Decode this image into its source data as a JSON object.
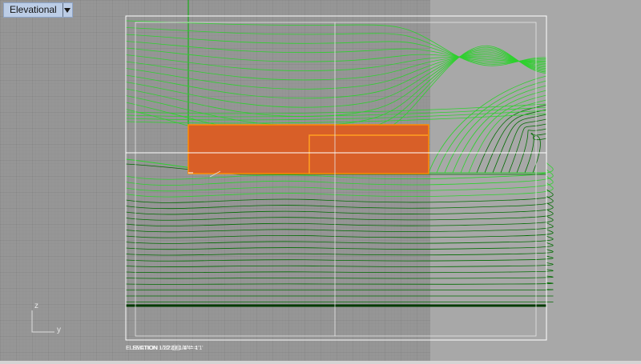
{
  "viewport": {
    "title": "Elevational",
    "menu_icon": "triangle-down-icon",
    "caption_text": "ELEVATION 1/22 @ 1/4\" = 1'",
    "caption_overlap_text": "SECTION - 1/22 @ 1/4\" = 1'",
    "axes": {
      "vertical_label": "z",
      "horizontal_label": "y"
    },
    "colors": {
      "background_left": "#969696",
      "background_right": "#a8a8a8",
      "grid": "#8b8b8b",
      "frame": "#ffffff",
      "contour_light": "#2ed12e",
      "contour_dark": "#006b00",
      "object_fill": "#d85f28",
      "object_edge": "#ff8c00",
      "tab_bg": "#bccde6"
    }
  }
}
